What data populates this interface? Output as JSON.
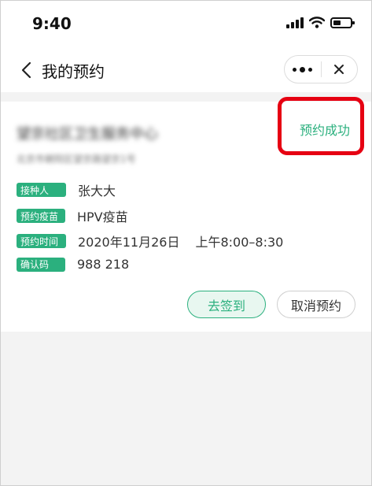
{
  "status_bar": {
    "time": "9:40",
    "icons": [
      "signal-icon",
      "wifi-icon",
      "battery-icon"
    ]
  },
  "nav": {
    "title": "我的预约",
    "back_icon": "chevron-left-icon",
    "more_icon": "more-dots-icon",
    "close_icon": "close-icon"
  },
  "appointment": {
    "org_name": "望京社区卫生服务中心",
    "org_address": "北京市朝阳区望京路望京1号",
    "status": "预约成功",
    "fields": {
      "person_label": "接种人",
      "person_value": "张大大",
      "vaccine_label": "预约疫苗",
      "vaccine_value": "HPV疫苗",
      "time_label": "预约时间",
      "date_value": "2020年11月26日",
      "time_value": "上午8:00–8:30",
      "code_label": "确认码",
      "code_value": "988 218"
    },
    "actions": {
      "checkin_label": "去签到",
      "cancel_label": "取消预约"
    }
  },
  "colors": {
    "accent": "#2bb07e",
    "highlight_box": "#e60012",
    "page_bg": "#f3f3f3"
  }
}
